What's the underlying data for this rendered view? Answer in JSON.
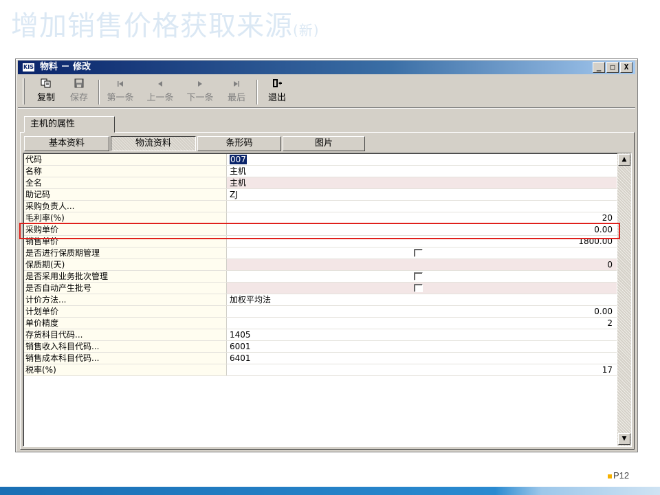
{
  "slide": {
    "title": "增加销售价格获取来源",
    "title_suffix": "(新)",
    "page_number": "P12"
  },
  "window": {
    "app_icon": "KIS",
    "title": "物料 － 修改",
    "controls": {
      "minimize": "_",
      "maximize": "□",
      "close": "X"
    }
  },
  "toolbar": {
    "copy": "复制",
    "save": "保存",
    "first": "第一条",
    "prev": "上一条",
    "next": "下一条",
    "last": "最后",
    "exit": "退出"
  },
  "tabs": {
    "outer": "主机的属性",
    "inner": [
      "基本资料",
      "物流资料",
      "条形码",
      "图片"
    ]
  },
  "properties": [
    {
      "label": "代码",
      "value": "007"
    },
    {
      "label": "名称",
      "value": "主机"
    },
    {
      "label": "全名",
      "value": "主机"
    },
    {
      "label": "助记码",
      "value": "ZJ"
    },
    {
      "label": "采购负责人...",
      "value": ""
    },
    {
      "label": "毛利率(%)",
      "value": "20"
    },
    {
      "label": "采购单价",
      "value": "0.00"
    },
    {
      "label": "销售单价",
      "value": "1800.00"
    },
    {
      "label": "是否进行保质期管理",
      "value": ""
    },
    {
      "label": "保质期(天)",
      "value": "0"
    },
    {
      "label": "是否采用业务批次管理",
      "value": ""
    },
    {
      "label": "是否自动产生批号",
      "value": ""
    },
    {
      "label": "计价方法...",
      "value": "加权平均法"
    },
    {
      "label": "计划单价",
      "value": "0.00"
    },
    {
      "label": "单价精度",
      "value": "2"
    },
    {
      "label": "存货科目代码...",
      "value": "1405"
    },
    {
      "label": "销售收入科目代码...",
      "value": "6001"
    },
    {
      "label": "销售成本科目代码...",
      "value": "6401"
    },
    {
      "label": "税率(%)",
      "value": "17"
    }
  ],
  "colors": {
    "titlebar": "#0a246a",
    "highlight": "#e0201c",
    "page_bar": "#1a6fb4"
  }
}
